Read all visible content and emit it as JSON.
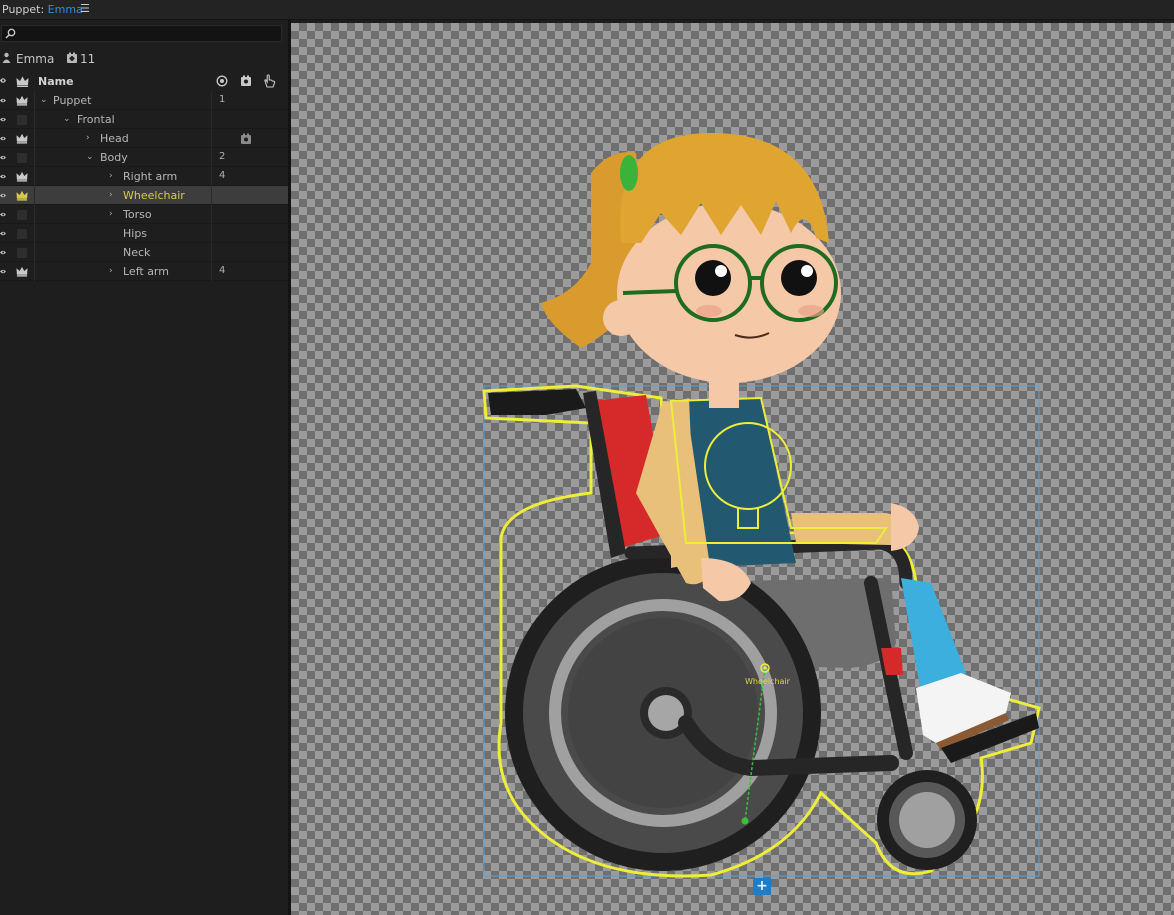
{
  "panel": {
    "title_prefix": "Puppet:",
    "title_name": "Emma",
    "menu_icon": "hamburger-icon"
  },
  "puppet_info": {
    "name": "Emma",
    "count": "11"
  },
  "columns": {
    "name": "Name",
    "icons": [
      "record-icon",
      "camera-tag-icon",
      "hand-tag-icon"
    ]
  },
  "layers": [
    {
      "label": "Puppet",
      "num": "1",
      "expanded": true,
      "crown": true
    },
    {
      "label": "Frontal",
      "num": "",
      "expanded": true,
      "crown": false
    },
    {
      "label": "Head",
      "num": "",
      "expanded": false,
      "crown": true,
      "camera": true
    },
    {
      "label": "Body",
      "num": "2",
      "expanded": true,
      "crown": false
    },
    {
      "label": "Right arm",
      "num": "4",
      "expanded": false,
      "crown": true
    },
    {
      "label": "Wheelchair",
      "num": "",
      "expanded": false,
      "crown": true,
      "selected": true
    },
    {
      "label": "Torso",
      "num": "",
      "expanded": false,
      "crown": false
    },
    {
      "label": "Hips",
      "num": "",
      "expanded": null,
      "crown": false
    },
    {
      "label": "Neck",
      "num": "",
      "expanded": null,
      "crown": false
    },
    {
      "label": "Left arm",
      "num": "4",
      "expanded": false,
      "crown": true
    }
  ],
  "canvas": {
    "handle_label": "Wheelchair",
    "add_label": "+"
  },
  "colors": {
    "accent_blue": "#2d8ceb",
    "selection_yellow": "#d6c94a",
    "outline_yellow": "#e8e83a"
  }
}
